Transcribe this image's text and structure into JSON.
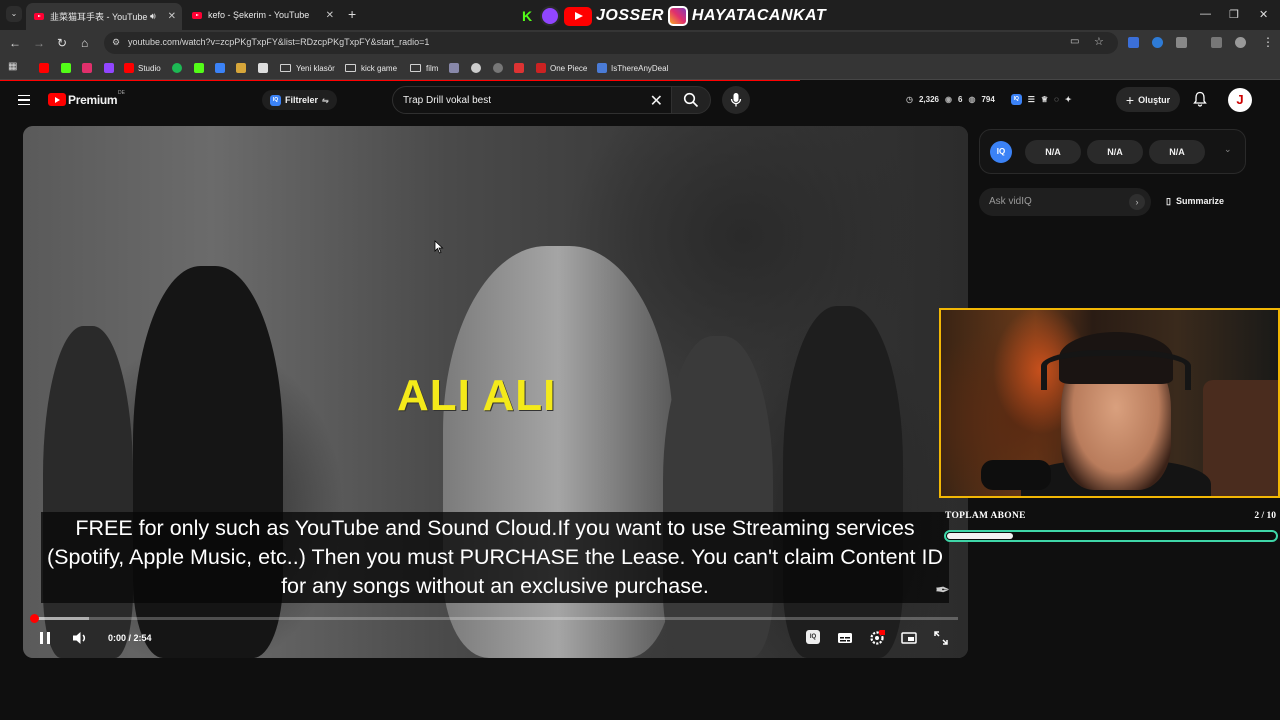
{
  "browser": {
    "tabs": [
      {
        "title": "韭菜猫耳手表 - YouTube",
        "active": true
      },
      {
        "title": "kefo - Şekerim - YouTube",
        "active": false
      }
    ],
    "new_tab": "+",
    "url": "youtube.com/watch?v=zcpPKgTxpFY&list=RDzcpPKgTxpFY&start_radio=1",
    "bookmarks": [
      "Studio",
      "Yeni klasör",
      "kick game",
      "film",
      "One Piece",
      "IsThereAnyDeal"
    ]
  },
  "stream_banner": {
    "youtube_name": "JOSSER",
    "instagram_name": "HAYATACANKAT"
  },
  "youtube": {
    "logo": "Premium",
    "region": "DE",
    "filters_label": "Filtreler",
    "search_value": "Trap Drill vokal best",
    "stats": {
      "views": "2,326",
      "eye": "6",
      "subs": "794"
    },
    "create_label": "Oluştur",
    "avatar_letter": "J"
  },
  "video": {
    "overlay_title": "ALI ALI",
    "caption": "FREE for only such as YouTube and Sound Cloud.If you want to use Streaming services (Spotify, Apple Music, etc..) Then you must PURCHASE the Lease. You can't claim Content ID for any songs without an exclusive purchase.",
    "time": "0:00 / 2:54",
    "progress_fraction": 0.0
  },
  "vidiq": {
    "badge": "IQ",
    "metrics": [
      "N/A",
      "N/A",
      "N/A"
    ],
    "ask_placeholder": "Ask vidIQ",
    "summarize_label": "Summarize"
  },
  "sub_goal": {
    "label": "TOPLAM ABONE",
    "count": "2 / 10",
    "current": 2,
    "target": 10
  },
  "colors": {
    "accent_red": "#ff0000",
    "webcam_border": "#f2b705",
    "goal_border": "#3fd6a8",
    "title_yellow": "#f4ea1a"
  }
}
